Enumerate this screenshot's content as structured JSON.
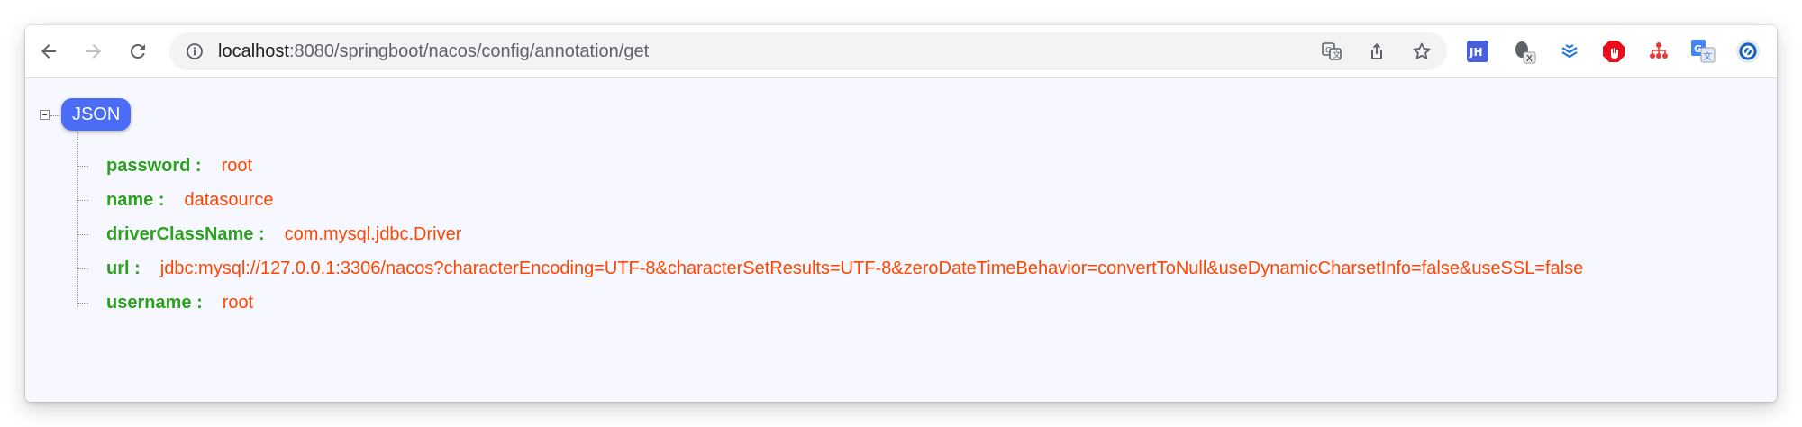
{
  "browser": {
    "url_host": "localhost",
    "url_path": ":8080/springboot/nacos/config/annotation/get",
    "icons": [
      "back-icon",
      "forward-icon",
      "reload-icon",
      "info-icon",
      "translate-icon",
      "share-icon",
      "bookmark-star-icon"
    ],
    "extensions": [
      {
        "name": "jh-extension-icon",
        "label": "JH",
        "color": "#4a5fdc"
      },
      {
        "name": "x-extension-icon",
        "label": "X",
        "color": "#5f6368"
      },
      {
        "name": "layers-extension-icon",
        "label": "",
        "color": "#1a73e8"
      },
      {
        "name": "adblock-extension-icon",
        "label": "",
        "color": "#e8101c"
      },
      {
        "name": "tree-extension-icon",
        "label": "",
        "color": "#e53935"
      },
      {
        "name": "google-translate-extension-icon",
        "label": "G",
        "color": "#4285f4"
      },
      {
        "name": "circle-extension-icon",
        "label": "",
        "color": "#1565c0"
      },
      {
        "name": "puzzle-extension-icon",
        "label": "",
        "color": "#202124"
      }
    ]
  },
  "json_viewer": {
    "root_label": "JSON",
    "separator": ":",
    "entries": [
      {
        "key": "password",
        "value": "root"
      },
      {
        "key": "name",
        "value": "datasource"
      },
      {
        "key": "driverClassName",
        "value": "com.mysql.jdbc.Driver"
      },
      {
        "key": "url",
        "value": "jdbc:mysql://127.0.0.1:3306/nacos?characterEncoding=UTF-8&characterSetResults=UTF-8&zeroDateTimeBehavior=convertToNull&useDynamicCharsetInfo=false&useSSL=false"
      },
      {
        "key": "username",
        "value": "root"
      }
    ]
  }
}
